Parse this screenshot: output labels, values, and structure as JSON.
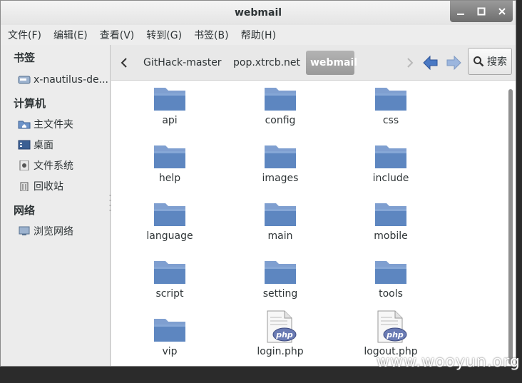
{
  "window": {
    "title": "webmail"
  },
  "menubar": {
    "items": [
      "文件(F)",
      "编辑(E)",
      "查看(V)",
      "转到(G)",
      "书签(B)",
      "帮助(H)"
    ]
  },
  "sidebar": {
    "sections": [
      {
        "header": "书签",
        "items": [
          {
            "label": "x-nautilus-de...",
            "icon": "drive-icon"
          }
        ]
      },
      {
        "header": "计算机",
        "items": [
          {
            "label": "主文件夹",
            "icon": "home-folder-icon"
          },
          {
            "label": "桌面",
            "icon": "desktop-icon"
          },
          {
            "label": "文件系统",
            "icon": "filesystem-icon"
          },
          {
            "label": "回收站",
            "icon": "trash-icon"
          }
        ]
      },
      {
        "header": "网络",
        "items": [
          {
            "label": "浏览网络",
            "icon": "network-icon"
          }
        ]
      }
    ]
  },
  "toolbar": {
    "breadcrumbs": [
      "GitHack-master",
      "pop.xtrcb.net",
      "webmail"
    ],
    "search_label": "搜索"
  },
  "files": [
    {
      "name": "api",
      "type": "folder"
    },
    {
      "name": "config",
      "type": "folder"
    },
    {
      "name": "css",
      "type": "folder"
    },
    {
      "name": "help",
      "type": "folder"
    },
    {
      "name": "images",
      "type": "folder"
    },
    {
      "name": "include",
      "type": "folder"
    },
    {
      "name": "language",
      "type": "folder"
    },
    {
      "name": "main",
      "type": "folder"
    },
    {
      "name": "mobile",
      "type": "folder"
    },
    {
      "name": "script",
      "type": "folder"
    },
    {
      "name": "setting",
      "type": "folder"
    },
    {
      "name": "tools",
      "type": "folder"
    },
    {
      "name": "vip",
      "type": "folder"
    },
    {
      "name": "login.php",
      "type": "php"
    },
    {
      "name": "logout.php",
      "type": "php"
    }
  ],
  "php_badge": "php",
  "watermark": "www.wooyun.org",
  "colors": {
    "folder": "#5d86c0",
    "active_crumb": "#a6a6a6",
    "nav_arrow": "#4a79c4"
  }
}
